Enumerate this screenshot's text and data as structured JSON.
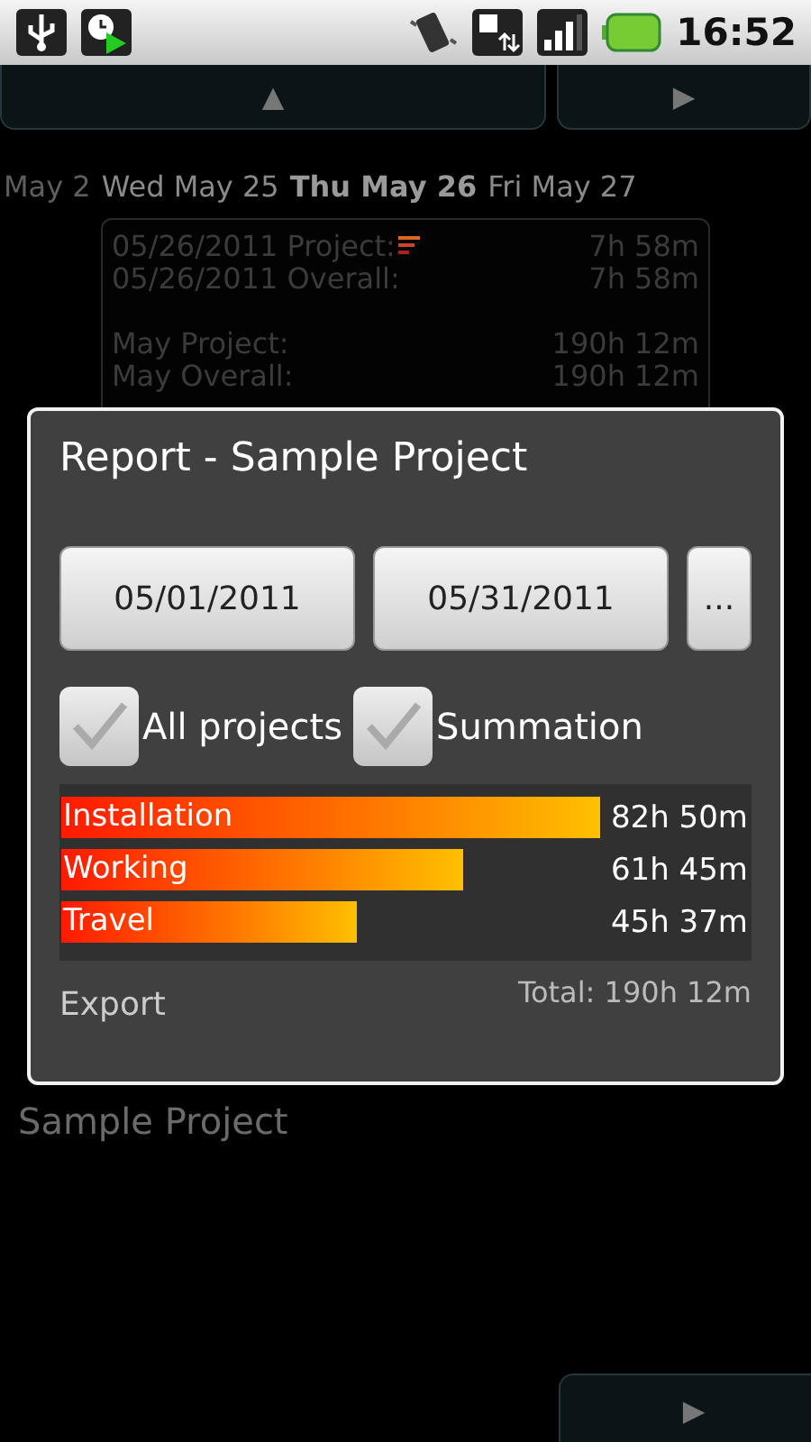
{
  "status_bar": {
    "time": "16:52"
  },
  "nav": {
    "up_symbol": "▲",
    "next_symbol": "▶"
  },
  "days": [
    {
      "label": "May 2",
      "selected": false,
      "kind": "faded"
    },
    {
      "label": "Wed May 25",
      "selected": false,
      "kind": "day"
    },
    {
      "label": "Thu May 26",
      "selected": true,
      "kind": "day"
    },
    {
      "label": "Fri May 27",
      "selected": false,
      "kind": "day"
    }
  ],
  "summary": [
    {
      "label": "05/26/2011 Project:",
      "value": "7h 58m",
      "flag": true
    },
    {
      "label": "05/26/2011 Overall:",
      "value": "7h 58m",
      "flag": false
    },
    {
      "label": "May Project:",
      "value": "190h 12m",
      "flag": false,
      "gap": true
    },
    {
      "label": "May Overall:",
      "value": "190h 12m",
      "flag": false
    }
  ],
  "project_name": "Sample Project",
  "bottom_next_symbol": "▶",
  "dialog": {
    "title": "Report - Sample Project",
    "date_buttons": [
      "05/01/2011",
      "05/31/2011",
      "..."
    ],
    "checkboxes": [
      {
        "label": "All projects",
        "checked": true
      },
      {
        "label": "Summation",
        "checked": true
      }
    ],
    "bars": [
      {
        "label": "Installation",
        "value": "82h 50m"
      },
      {
        "label": "Working",
        "value": "61h 45m"
      },
      {
        "label": "Travel",
        "value": "45h 37m"
      }
    ],
    "export": "Export",
    "total": "Total: 190h 12m"
  }
}
